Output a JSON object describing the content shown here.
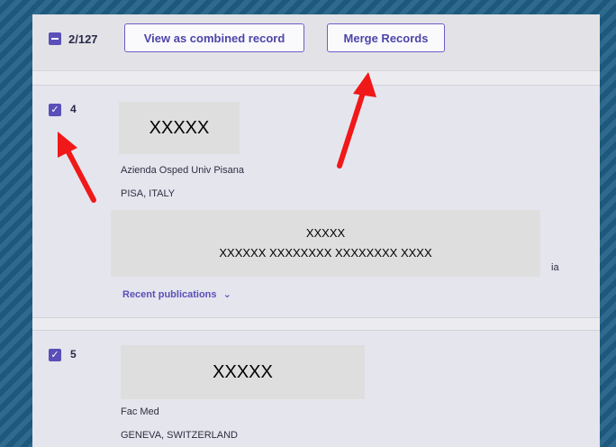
{
  "toolbar": {
    "selection_count": "2/127",
    "view_combined_label": "View as combined record",
    "merge_label": "Merge Records"
  },
  "records": [
    {
      "number": "4",
      "name_redacted": "XXXXX",
      "institution": "Azienda Osped Univ Pisana",
      "location": "PISA, ITALY",
      "detail_redacted_line1": "XXXXX",
      "detail_redacted_line2": "XXXXXX XXXXXXXX XXXXXXXX XXXX",
      "detail_partial_suffix": "ia",
      "recent_publications_label": "Recent publications",
      "checked": true
    },
    {
      "number": "5",
      "name_redacted": "XXXXX",
      "institution": "Fac Med",
      "location": "GENEVA, SWITZERLAND",
      "checked": true
    }
  ],
  "colors": {
    "accent": "#5a4fb8",
    "annotation_arrow": "#f01818"
  }
}
